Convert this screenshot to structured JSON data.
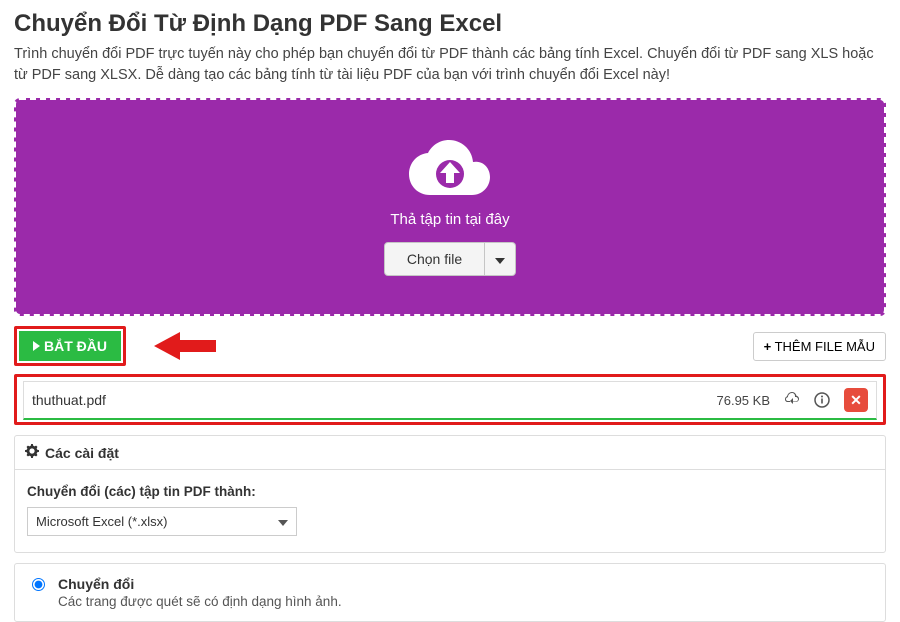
{
  "title": "Chuyển Đổi Từ Định Dạng PDF Sang Excel",
  "subtitle": "Trình chuyển đổi PDF trực tuyến này cho phép bạn chuyển đổi từ PDF thành các bảng tính Excel. Chuyển đổi từ PDF sang XLS hoặc từ PDF sang XLSX. Dễ dàng tạo các bảng tính từ tài liệu PDF của bạn với trình chuyển đổi Excel này!",
  "dropzone": {
    "drop_text": "Thả tập tin tại đây",
    "choose_file": "Chọn file"
  },
  "actions": {
    "start_label": "BẮT ĐẦU",
    "sample_label": "THÊM FILE MẪU"
  },
  "file": {
    "name": "thuthuat.pdf",
    "size": "76.95 KB"
  },
  "settings": {
    "panel_title": "Các cài đặt",
    "format_label": "Chuyển đổi (các) tập tin PDF thành:",
    "format_value": "Microsoft Excel (*.xlsx)"
  },
  "option": {
    "title": "Chuyển đổi",
    "desc": "Các trang được quét sẽ có định dạng hình ảnh."
  }
}
